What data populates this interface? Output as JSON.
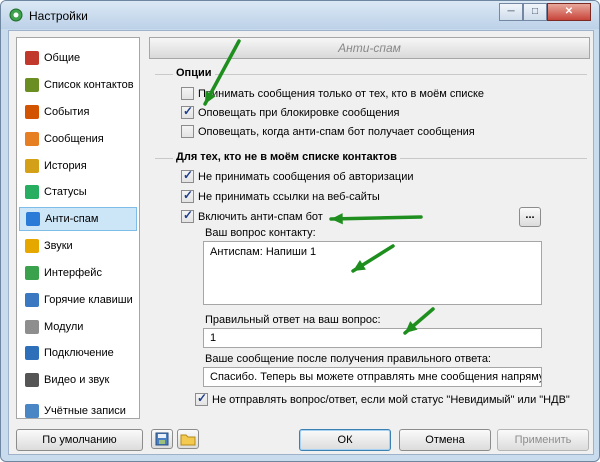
{
  "window": {
    "title": "Настройки",
    "min_glyph": "─",
    "max_glyph": "□",
    "close_glyph": "✕"
  },
  "sidebar": {
    "items": [
      {
        "label": "Общие",
        "icon": "gear-icon",
        "color": "#c0392b",
        "selected": false
      },
      {
        "label": "Список контактов",
        "icon": "contacts-icon",
        "color": "#6b8e23",
        "selected": false
      },
      {
        "label": "События",
        "icon": "events-icon",
        "color": "#d35400",
        "selected": false
      },
      {
        "label": "Сообщения",
        "icon": "messages-icon",
        "color": "#e67e22",
        "selected": false
      },
      {
        "label": "История",
        "icon": "history-icon",
        "color": "#d4a017",
        "selected": false
      },
      {
        "label": "Статусы",
        "icon": "statuses-icon",
        "color": "#27ae60",
        "selected": false
      },
      {
        "label": "Анти-спам",
        "icon": "antispam-icon",
        "color": "#2a7ad8",
        "selected": true
      },
      {
        "label": "Звуки",
        "icon": "sounds-icon",
        "color": "#e6a800",
        "selected": false
      },
      {
        "label": "Интерфейс",
        "icon": "interface-icon",
        "color": "#3aa14c",
        "selected": false
      },
      {
        "label": "Горячие клавиши",
        "icon": "hotkeys-icon",
        "color": "#3a78c2",
        "selected": false
      },
      {
        "label": "Модули",
        "icon": "modules-icon",
        "color": "#8e8e8e",
        "selected": false
      },
      {
        "label": "Подключение",
        "icon": "connection-icon",
        "color": "#2d6fb8",
        "selected": false
      },
      {
        "label": "Видео и звук",
        "icon": "video-sound-icon",
        "color": "#555555",
        "selected": false
      },
      {
        "label": "Учётные записи",
        "icon": "accounts-icon",
        "color": "#4a86c5",
        "selected": false
      }
    ]
  },
  "panel": {
    "title": "Анти-спам",
    "options_group": {
      "title": "Опции",
      "items": [
        {
          "label": "Принимать сообщения только от тех, кто в моём списке",
          "checked": false
        },
        {
          "label": "Оповещать при блокировке сообщения",
          "checked": true
        },
        {
          "label": "Оповещать, когда анти-спам бот получает сообщения",
          "checked": false
        }
      ]
    },
    "others_group": {
      "title": "Для тех, кто не в моём списке контактов",
      "items": [
        {
          "label": "Не принимать сообщения об авторизации",
          "checked": true
        },
        {
          "label": "Не принимать ссылки на веб-сайты",
          "checked": true
        },
        {
          "label": "Включить анти-спам бот",
          "checked": true
        }
      ],
      "more_button": "...",
      "question_label": "Ваш вопрос контакту:",
      "question_value": "Антиспам: Напиши 1",
      "answer_label": "Правильный ответ на ваш вопрос:",
      "answer_value": "1",
      "message_label": "Ваше сообщение после получения правильного ответа:",
      "message_value": "Спасибо. Теперь вы можете отправлять мне сообщения напрямую.",
      "invisible_label": "Не отправлять вопрос/ответ, если мой статус \"Невидимый\" или \"НДВ\"",
      "invisible_checked": true
    }
  },
  "footer": {
    "default_button": "По умолчанию",
    "ok_button": "ОК",
    "cancel_button": "Отмена",
    "apply_button": "Применить"
  },
  "colors": {
    "arrow": "#1e8f1e",
    "selection": "#cde6f7"
  }
}
